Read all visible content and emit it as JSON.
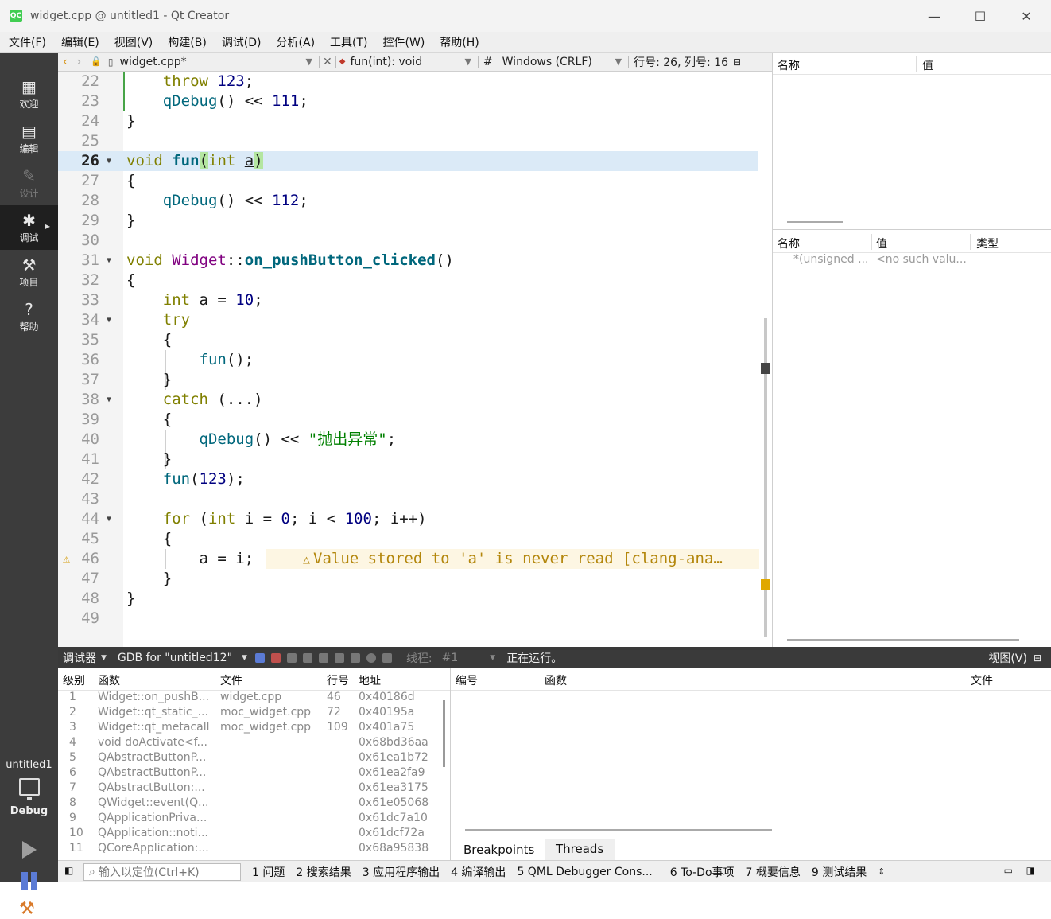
{
  "window": {
    "logo": "QC",
    "title": "widget.cpp @ untitled1 - Qt Creator",
    "minimize": "—",
    "maximize": "☐",
    "close": "✕"
  },
  "menu": [
    "文件(F)",
    "编辑(E)",
    "视图(V)",
    "构建(B)",
    "调试(D)",
    "分析(A)",
    "工具(T)",
    "控件(W)",
    "帮助(H)"
  ],
  "modes": [
    {
      "label": "欢迎",
      "icon": "grid-icon"
    },
    {
      "label": "编辑",
      "icon": "edit-icon"
    },
    {
      "label": "设计",
      "icon": "pencil-icon"
    },
    {
      "label": "调试",
      "icon": "bug-icon"
    },
    {
      "label": "项目",
      "icon": "wrench-icon"
    },
    {
      "label": "帮助",
      "icon": "help-icon"
    }
  ],
  "kit": {
    "project": "untitled1",
    "build": "Debug"
  },
  "editor_toolbar": {
    "file": "widget.cpp*",
    "symbol": "fun(int): void",
    "encoding_hash": "#",
    "line_ending": "Windows (CRLF)",
    "position": "行号: 26, 列号: 16"
  },
  "code_lines": [
    {
      "n": "22",
      "text": "    throw 123;"
    },
    {
      "n": "23",
      "text": "    qDebug() << 111;"
    },
    {
      "n": "24",
      "text": "}"
    },
    {
      "n": "25",
      "text": ""
    },
    {
      "n": "26",
      "text": "void fun(int a)"
    },
    {
      "n": "27",
      "text": "{"
    },
    {
      "n": "28",
      "text": "    qDebug() << 112;"
    },
    {
      "n": "29",
      "text": "}"
    },
    {
      "n": "30",
      "text": ""
    },
    {
      "n": "31",
      "text": "void Widget::on_pushButton_clicked()"
    },
    {
      "n": "32",
      "text": "{"
    },
    {
      "n": "33",
      "text": "    int a = 10;"
    },
    {
      "n": "34",
      "text": "    try"
    },
    {
      "n": "35",
      "text": "    {"
    },
    {
      "n": "36",
      "text": "        fun();"
    },
    {
      "n": "37",
      "text": "    }"
    },
    {
      "n": "38",
      "text": "    catch (...)"
    },
    {
      "n": "39",
      "text": "    {"
    },
    {
      "n": "40",
      "text": "        qDebug() << \"抛出异常\";"
    },
    {
      "n": "41",
      "text": "    }"
    },
    {
      "n": "42",
      "text": "    fun(123);"
    },
    {
      "n": "43",
      "text": ""
    },
    {
      "n": "44",
      "text": "    for (int i = 0; i < 100; i++)"
    },
    {
      "n": "45",
      "text": "    {"
    },
    {
      "n": "46",
      "text": "        a = i;"
    },
    {
      "n": "47",
      "text": "    }"
    },
    {
      "n": "48",
      "text": "}"
    },
    {
      "n": "49",
      "text": ""
    }
  ],
  "warning": "Value stored to 'a' is never read [clang-ana…",
  "warning_icon": "⚠",
  "locals_panel": {
    "name": "名称",
    "value": "值"
  },
  "watch_panel": {
    "name": "名称",
    "value": "值",
    "type": "类型",
    "row": {
      "name": "*(unsigned ...",
      "value": "<no such valu..."
    }
  },
  "debug_toolbar": {
    "label": "调试器",
    "engine": "GDB for \"untitled12\"",
    "thread_label": "线程:",
    "thread_value": "#1",
    "status": "正在运行。",
    "view": "视图(V)"
  },
  "stack": {
    "headers": [
      "级别",
      "函数",
      "文件",
      "行号",
      "地址"
    ],
    "rows": [
      [
        "1",
        "Widget::on_pushB...",
        "widget.cpp",
        "46",
        "0x40186d"
      ],
      [
        "2",
        "Widget::qt_static_...",
        "moc_widget.cpp",
        "72",
        "0x40195a"
      ],
      [
        "3",
        "Widget::qt_metacall",
        "moc_widget.cpp",
        "109",
        "0x401a75"
      ],
      [
        "4",
        "void doActivate<f...",
        "",
        "",
        "0x68bd36aa"
      ],
      [
        "5",
        "QAbstractButtonP...",
        "",
        "",
        "0x61ea1b72"
      ],
      [
        "6",
        "QAbstractButtonP...",
        "",
        "",
        "0x61ea2fa9"
      ],
      [
        "7",
        "QAbstractButton:...",
        "",
        "",
        "0x61ea3175"
      ],
      [
        "8",
        "QWidget::event(Q...",
        "",
        "",
        "0x61e05068"
      ],
      [
        "9",
        "QApplicationPriva...",
        "",
        "",
        "0x61dc7a10"
      ],
      [
        "10",
        "QApplication::noti...",
        "",
        "",
        "0x61dcf72a"
      ],
      [
        "11",
        "QCoreApplication:...",
        "",
        "",
        "0x68a95838"
      ]
    ]
  },
  "breakpoints": {
    "headers": [
      "编号",
      "函数",
      "文件"
    ],
    "tabs": [
      "Breakpoints",
      "Threads"
    ]
  },
  "statusbar": {
    "locator_placeholder": "输入以定位(Ctrl+K)",
    "items": [
      "1 问题",
      "2 搜索结果",
      "3 应用程序输出",
      "4 编译输出",
      "5 QML Debugger Cons...",
      "6 To-Do事项",
      "7 概要信息",
      "9 测试结果"
    ]
  }
}
